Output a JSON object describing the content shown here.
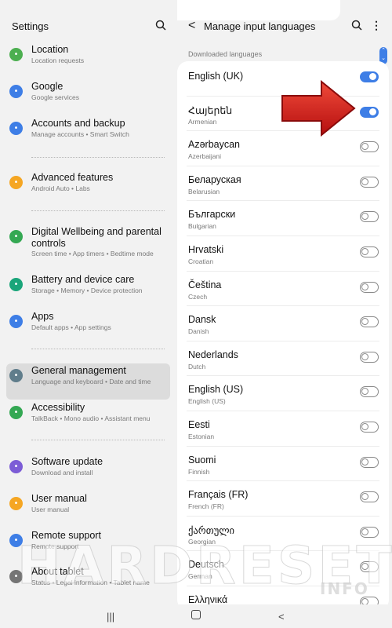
{
  "statusbar": {
    "icons": [
      "gear-icon",
      "shield-icon",
      "image-icon"
    ]
  },
  "left": {
    "title": "Settings",
    "items": [
      {
        "title": "Location",
        "sub": "Location requests",
        "icon": "location-icon",
        "color": "#4caf50"
      },
      {
        "title": "Google",
        "sub": "Google services",
        "icon": "google-icon",
        "color": "#3e7ee6"
      },
      {
        "title": "Accounts and backup",
        "sub": "Manage accounts  •  Smart Switch",
        "icon": "sync-icon",
        "color": "#3e7ee6"
      },
      {
        "title": "Advanced features",
        "sub": "Android Auto  •  Labs",
        "icon": "gear-plus-icon",
        "color": "#f5a623"
      },
      {
        "title": "Digital Wellbeing and parental controls",
        "sub": "Screen time  •  App timers  •  Bedtime mode",
        "icon": "wellbeing-icon",
        "color": "#34a853"
      },
      {
        "title": "Battery and device care",
        "sub": "Storage  •  Memory  •  Device protection",
        "icon": "device-care-icon",
        "color": "#1aa57a"
      },
      {
        "title": "Apps",
        "sub": "Default apps  •  App settings",
        "icon": "apps-icon",
        "color": "#3e7ee6"
      },
      {
        "title": "General management",
        "sub": "Language and keyboard  •  Date and time",
        "icon": "sliders-icon",
        "color": "#607d8b"
      },
      {
        "title": "Accessibility",
        "sub": "TalkBack  •  Mono audio  •  Assistant menu",
        "icon": "accessibility-icon",
        "color": "#34a853"
      },
      {
        "title": "Software update",
        "sub": "Download and install",
        "icon": "update-icon",
        "color": "#7c5cd6"
      },
      {
        "title": "User manual",
        "sub": "User manual",
        "icon": "manual-icon",
        "color": "#f5a623"
      },
      {
        "title": "Remote support",
        "sub": "Remote support",
        "icon": "headset-icon",
        "color": "#3e7ee6"
      },
      {
        "title": "About tablet",
        "sub": "Status  •  Legal information  •  Tablet name",
        "icon": "info-icon",
        "color": "#757575"
      }
    ]
  },
  "right": {
    "title": "Manage input languages",
    "section_label": "Downloaded languages",
    "languages": [
      {
        "name": "English (UK)",
        "sub": "",
        "on": true
      },
      {
        "name": "Հայերեն",
        "sub": "Armenian",
        "on": true
      },
      {
        "name": "Azərbaycan",
        "sub": "Azerbaijani",
        "on": false
      },
      {
        "name": "Беларуская",
        "sub": "Belarusian",
        "on": false
      },
      {
        "name": "Български",
        "sub": "Bulgarian",
        "on": false
      },
      {
        "name": "Hrvatski",
        "sub": "Croatian",
        "on": false
      },
      {
        "name": "Čeština",
        "sub": "Czech",
        "on": false
      },
      {
        "name": "Dansk",
        "sub": "Danish",
        "on": false
      },
      {
        "name": "Nederlands",
        "sub": "Dutch",
        "on": false
      },
      {
        "name": "English (US)",
        "sub": "English (US)",
        "on": false
      },
      {
        "name": "Eesti",
        "sub": "Estonian",
        "on": false
      },
      {
        "name": "Suomi",
        "sub": "Finnish",
        "on": false
      },
      {
        "name": "Français (FR)",
        "sub": "French (FR)",
        "on": false
      },
      {
        "name": "ქართული",
        "sub": "Georgian",
        "on": false
      },
      {
        "name": "Deutsch",
        "sub": "German",
        "on": false
      },
      {
        "name": "Ελληνικά",
        "sub": "",
        "on": false
      }
    ]
  },
  "watermark": {
    "text": "HARDRESET",
    "sub": "INFO"
  },
  "colors": {
    "accent": "#3e7ee6",
    "arrow": "#d91a1a"
  }
}
